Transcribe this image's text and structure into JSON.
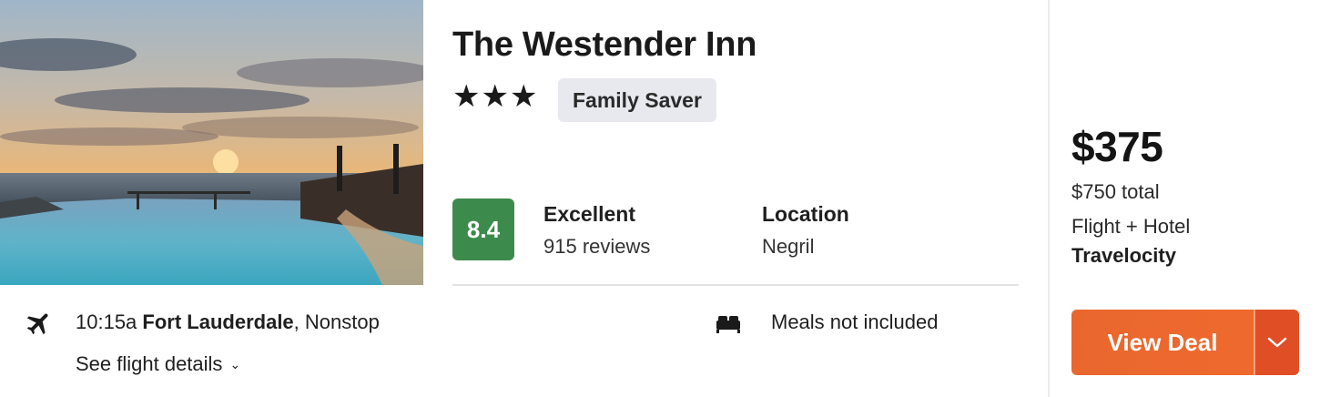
{
  "hotel": {
    "name": "The Westender Inn",
    "stars": "★★★",
    "star_count": 3,
    "badge": "Family Saver",
    "score": "8.4",
    "score_color": "#3d8b4c",
    "rating_label": "Excellent",
    "review_count": "915 reviews",
    "location_label": "Location",
    "location_value": "Negril",
    "photo_icon": "sunset-pool-photo"
  },
  "flight": {
    "icon": "airplane-icon",
    "time": "10:15a",
    "origin": "Fort Lauderdale",
    "stops": ", Nonstop",
    "details_link": "See flight details",
    "chevron_icon": "chevron-down-icon"
  },
  "amenities": {
    "icon": "bed-icon",
    "meals": "Meals not included"
  },
  "pricing": {
    "price": "$375",
    "total": "$750 total",
    "package": "Flight + Hotel",
    "provider": "Travelocity",
    "cta_label": "View Deal",
    "cta_color": "#e9672f",
    "cta_more_icon": "chevron-down-icon"
  }
}
